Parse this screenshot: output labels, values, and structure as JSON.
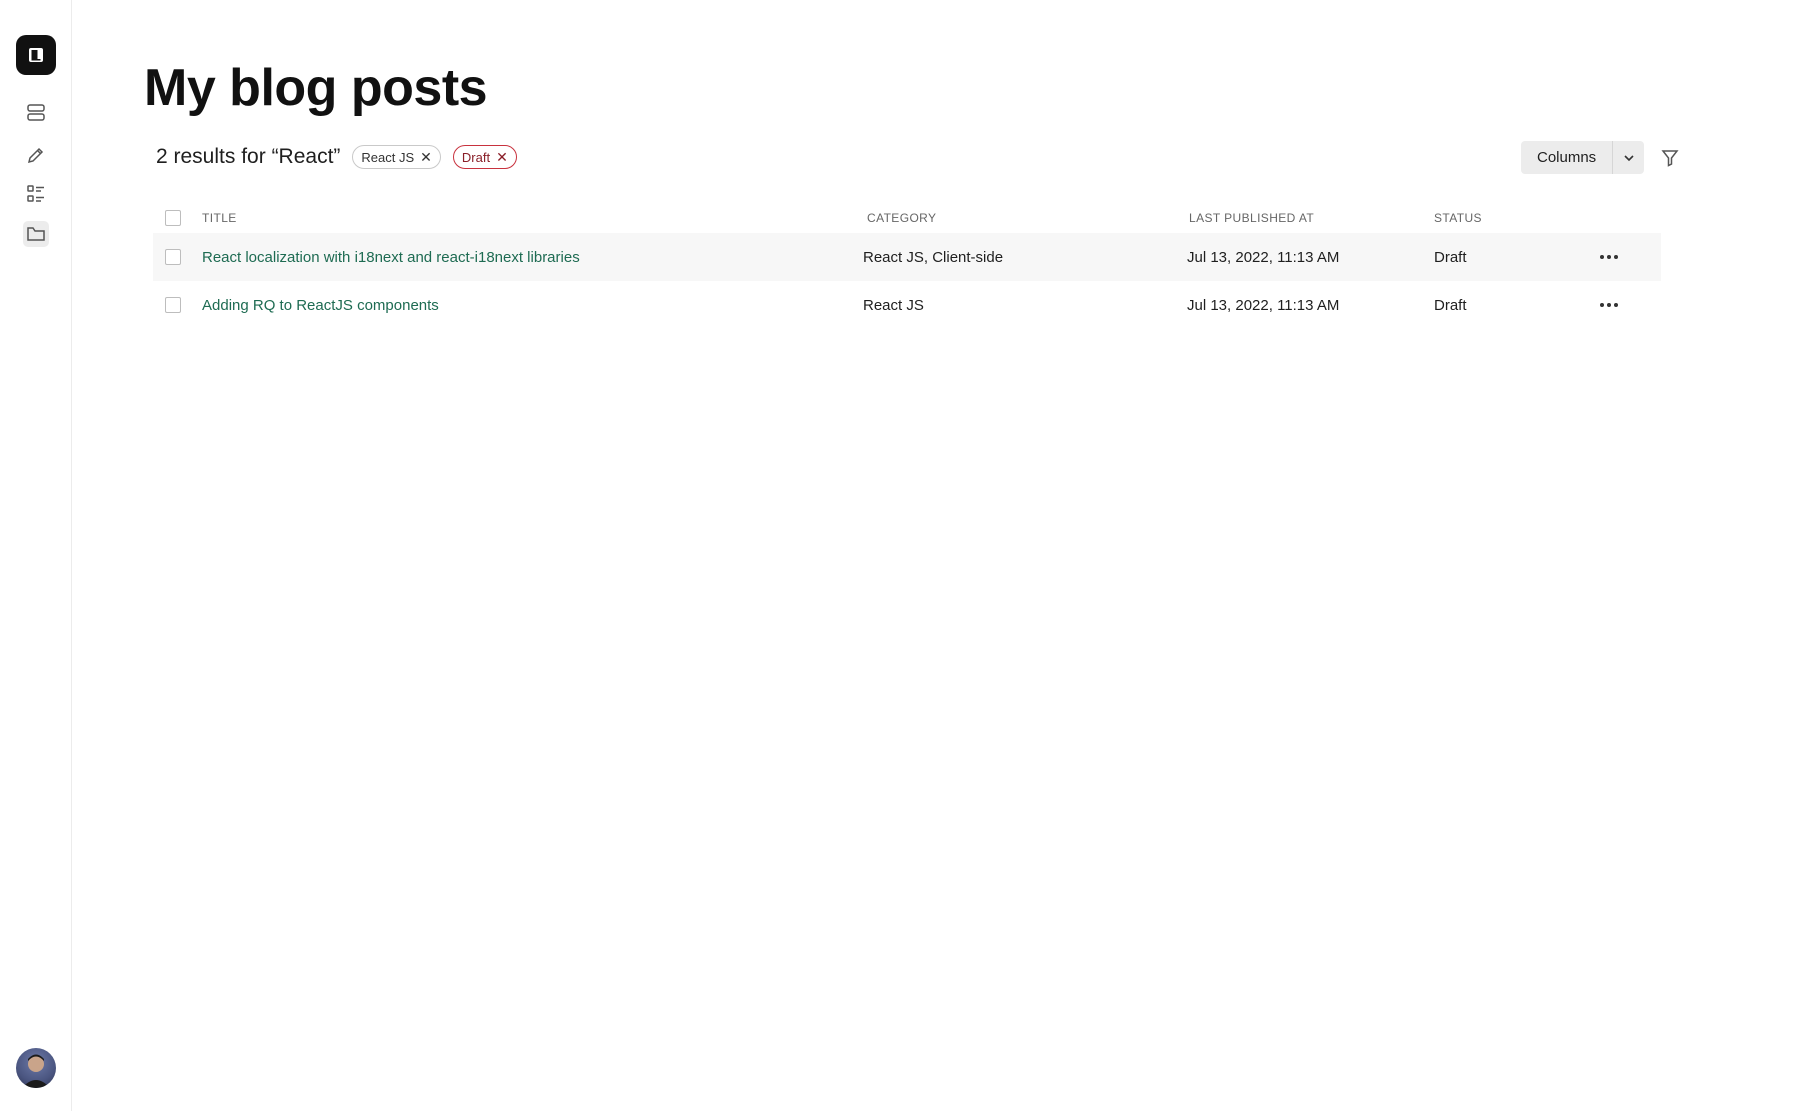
{
  "page": {
    "title": "My blog posts"
  },
  "search": {
    "count_text": "2 results for",
    "query": "“React”"
  },
  "filters": [
    {
      "label": "React JS",
      "color": "#c9c9c9"
    },
    {
      "label": "Draft",
      "color": "#c8323e"
    }
  ],
  "toolbar": {
    "columns_label": "Columns"
  },
  "table": {
    "columns": [
      "Title",
      "Category",
      "Last published at",
      "Status"
    ],
    "rows": [
      {
        "title": "React localization with i18next and react-i18next libraries",
        "category": "React JS, Client-side",
        "last_published": "Jul 13, 2022, 11:13 AM",
        "status": "Draft"
      },
      {
        "title": "Adding RQ to ReactJS components",
        "category": "React JS",
        "last_published": "Jul 13, 2022, 11:13 AM",
        "status": "Draft"
      }
    ]
  },
  "sidebar": {
    "icons": [
      "logo-icon",
      "database-icon",
      "pencil-icon",
      "list-icon",
      "folder-icon"
    ]
  },
  "colors": {
    "link": "#1e6b52",
    "draft_chip": "#c8323e",
    "row_highlight": "#f7f7f7"
  }
}
